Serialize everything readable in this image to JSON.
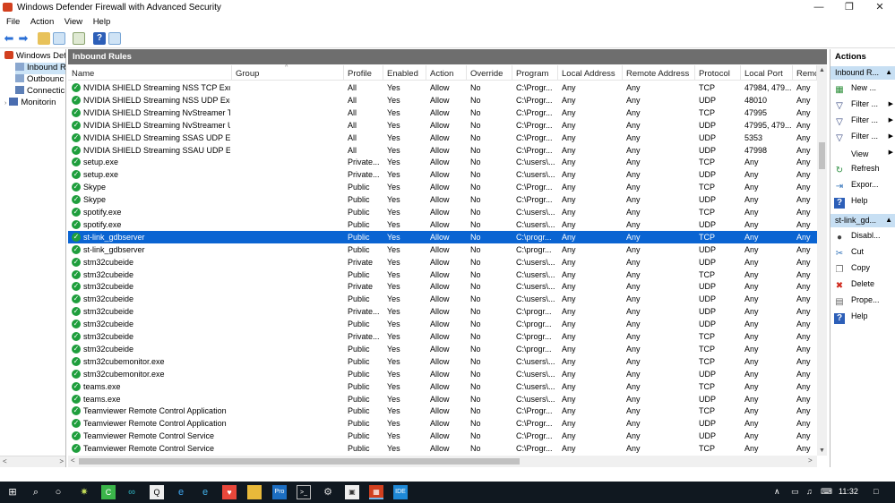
{
  "window": {
    "title": "Windows Defender Firewall with Advanced Security",
    "minimize": "—",
    "maximize": "❐",
    "close": "✕"
  },
  "menu": [
    "File",
    "Action",
    "View",
    "Help"
  ],
  "tree": {
    "items": [
      {
        "label": "Windows Defe",
        "icon": "firewall-icon"
      },
      {
        "label": "Inbound R",
        "icon": "inbound-rules-icon",
        "selected": true
      },
      {
        "label": "Outbounc",
        "icon": "outbound-rules-icon"
      },
      {
        "label": "Connectic",
        "icon": "connection-rules-icon"
      },
      {
        "label": "Monitorin",
        "icon": "monitoring-icon"
      }
    ]
  },
  "pane": {
    "header": "Inbound Rules",
    "columns": [
      "Name",
      "Group",
      "Profile",
      "Enabled",
      "Action",
      "Override",
      "Program",
      "Local Address",
      "Remote Address",
      "Protocol",
      "Local Port",
      "Remc"
    ],
    "rows": [
      [
        "NVIDIA SHIELD Streaming NSS TCP Excep...",
        "",
        "All",
        "Yes",
        "Allow",
        "No",
        "C:\\Progr...",
        "Any",
        "Any",
        "TCP",
        "47984, 479...",
        "Any"
      ],
      [
        "NVIDIA SHIELD Streaming NSS UDP Exce...",
        "",
        "All",
        "Yes",
        "Allow",
        "No",
        "C:\\Progr...",
        "Any",
        "Any",
        "UDP",
        "48010",
        "Any"
      ],
      [
        "NVIDIA SHIELD Streaming NvStreamer TC...",
        "",
        "All",
        "Yes",
        "Allow",
        "No",
        "C:\\Progr...",
        "Any",
        "Any",
        "TCP",
        "47995",
        "Any"
      ],
      [
        "NVIDIA SHIELD Streaming NvStreamer U...",
        "",
        "All",
        "Yes",
        "Allow",
        "No",
        "C:\\Progr...",
        "Any",
        "Any",
        "UDP",
        "47995, 479...",
        "Any"
      ],
      [
        "NVIDIA SHIELD Streaming SSAS UDP Exc...",
        "",
        "All",
        "Yes",
        "Allow",
        "No",
        "C:\\Progr...",
        "Any",
        "Any",
        "UDP",
        "5353",
        "Any"
      ],
      [
        "NVIDIA SHIELD Streaming SSAU UDP Exc...",
        "",
        "All",
        "Yes",
        "Allow",
        "No",
        "C:\\Progr...",
        "Any",
        "Any",
        "UDP",
        "47998",
        "Any"
      ],
      [
        "setup.exe",
        "",
        "Private...",
        "Yes",
        "Allow",
        "No",
        "C:\\users\\...",
        "Any",
        "Any",
        "TCP",
        "Any",
        "Any"
      ],
      [
        "setup.exe",
        "",
        "Private...",
        "Yes",
        "Allow",
        "No",
        "C:\\users\\...",
        "Any",
        "Any",
        "UDP",
        "Any",
        "Any"
      ],
      [
        "Skype",
        "",
        "Public",
        "Yes",
        "Allow",
        "No",
        "C:\\Progr...",
        "Any",
        "Any",
        "TCP",
        "Any",
        "Any"
      ],
      [
        "Skype",
        "",
        "Public",
        "Yes",
        "Allow",
        "No",
        "C:\\Progr...",
        "Any",
        "Any",
        "UDP",
        "Any",
        "Any"
      ],
      [
        "spotify.exe",
        "",
        "Public",
        "Yes",
        "Allow",
        "No",
        "C:\\users\\...",
        "Any",
        "Any",
        "TCP",
        "Any",
        "Any"
      ],
      [
        "spotify.exe",
        "",
        "Public",
        "Yes",
        "Allow",
        "No",
        "C:\\users\\...",
        "Any",
        "Any",
        "UDP",
        "Any",
        "Any"
      ],
      [
        "st-link_gdbserver",
        "",
        "Public",
        "Yes",
        "Allow",
        "No",
        "C:\\progr...",
        "Any",
        "Any",
        "TCP",
        "Any",
        "Any"
      ],
      [
        "st-link_gdbserver",
        "",
        "Public",
        "Yes",
        "Allow",
        "No",
        "C:\\progr...",
        "Any",
        "Any",
        "UDP",
        "Any",
        "Any"
      ],
      [
        "stm32cubeide",
        "",
        "Private",
        "Yes",
        "Allow",
        "No",
        "C:\\users\\...",
        "Any",
        "Any",
        "UDP",
        "Any",
        "Any"
      ],
      [
        "stm32cubeide",
        "",
        "Public",
        "Yes",
        "Allow",
        "No",
        "C:\\users\\...",
        "Any",
        "Any",
        "TCP",
        "Any",
        "Any"
      ],
      [
        "stm32cubeide",
        "",
        "Private",
        "Yes",
        "Allow",
        "No",
        "C:\\users\\...",
        "Any",
        "Any",
        "UDP",
        "Any",
        "Any"
      ],
      [
        "stm32cubeide",
        "",
        "Public",
        "Yes",
        "Allow",
        "No",
        "C:\\users\\...",
        "Any",
        "Any",
        "UDP",
        "Any",
        "Any"
      ],
      [
        "stm32cubeide",
        "",
        "Private...",
        "Yes",
        "Allow",
        "No",
        "C:\\progr...",
        "Any",
        "Any",
        "UDP",
        "Any",
        "Any"
      ],
      [
        "stm32cubeide",
        "",
        "Public",
        "Yes",
        "Allow",
        "No",
        "C:\\progr...",
        "Any",
        "Any",
        "UDP",
        "Any",
        "Any"
      ],
      [
        "stm32cubeide",
        "",
        "Private...",
        "Yes",
        "Allow",
        "No",
        "C:\\progr...",
        "Any",
        "Any",
        "TCP",
        "Any",
        "Any"
      ],
      [
        "stm32cubeide",
        "",
        "Public",
        "Yes",
        "Allow",
        "No",
        "C:\\progr...",
        "Any",
        "Any",
        "TCP",
        "Any",
        "Any"
      ],
      [
        "stm32cubemonitor.exe",
        "",
        "Public",
        "Yes",
        "Allow",
        "No",
        "C:\\users\\...",
        "Any",
        "Any",
        "TCP",
        "Any",
        "Any"
      ],
      [
        "stm32cubemonitor.exe",
        "",
        "Public",
        "Yes",
        "Allow",
        "No",
        "C:\\users\\...",
        "Any",
        "Any",
        "UDP",
        "Any",
        "Any"
      ],
      [
        "teams.exe",
        "",
        "Public",
        "Yes",
        "Allow",
        "No",
        "C:\\users\\...",
        "Any",
        "Any",
        "TCP",
        "Any",
        "Any"
      ],
      [
        "teams.exe",
        "",
        "Public",
        "Yes",
        "Allow",
        "No",
        "C:\\users\\...",
        "Any",
        "Any",
        "UDP",
        "Any",
        "Any"
      ],
      [
        "Teamviewer Remote Control Application",
        "",
        "Public",
        "Yes",
        "Allow",
        "No",
        "C:\\Progr...",
        "Any",
        "Any",
        "TCP",
        "Any",
        "Any"
      ],
      [
        "Teamviewer Remote Control Application",
        "",
        "Public",
        "Yes",
        "Allow",
        "No",
        "C:\\Progr...",
        "Any",
        "Any",
        "UDP",
        "Any",
        "Any"
      ],
      [
        "Teamviewer Remote Control Service",
        "",
        "Public",
        "Yes",
        "Allow",
        "No",
        "C:\\Progr...",
        "Any",
        "Any",
        "UDP",
        "Any",
        "Any"
      ],
      [
        "Teamviewer Remote Control Service",
        "",
        "Public",
        "Yes",
        "Allow",
        "No",
        "C:\\Progr...",
        "Any",
        "Any",
        "TCP",
        "Any",
        "Any"
      ]
    ],
    "selected_row": 12
  },
  "actions": {
    "title": "Actions",
    "section1": "Inbound R...",
    "section1_items": [
      {
        "label": "New ...",
        "icon": "new-rule-icon",
        "sub": false
      },
      {
        "label": "Filter ...",
        "icon": "filter-icon",
        "sub": true
      },
      {
        "label": "Filter ...",
        "icon": "filter-icon",
        "sub": true
      },
      {
        "label": "Filter ...",
        "icon": "filter-icon",
        "sub": true
      },
      {
        "label": "View",
        "icon": "blank",
        "sub": true
      },
      {
        "label": "Refresh",
        "icon": "refresh-icon",
        "sub": false
      },
      {
        "label": "Expor...",
        "icon": "export-icon",
        "sub": false
      },
      {
        "label": "Help",
        "icon": "help-icon",
        "sub": false
      }
    ],
    "section2": "st-link_gd...",
    "section2_items": [
      {
        "label": "Disabl...",
        "icon": "disable-icon"
      },
      {
        "label": "Cut",
        "icon": "cut-icon"
      },
      {
        "label": "Copy",
        "icon": "copy-icon"
      },
      {
        "label": "Delete",
        "icon": "delete-icon"
      },
      {
        "label": "Prope...",
        "icon": "properties-icon"
      },
      {
        "label": "Help",
        "icon": "help-icon"
      }
    ]
  },
  "taskbar": {
    "clock": "11:32",
    "accent": "#76b9ed"
  },
  "colors": {
    "selection": "#0a64d2",
    "pane_header": "#6e6e6e",
    "actions_section": "#c7dff3",
    "rule_enabled": "#1e9e3c"
  }
}
